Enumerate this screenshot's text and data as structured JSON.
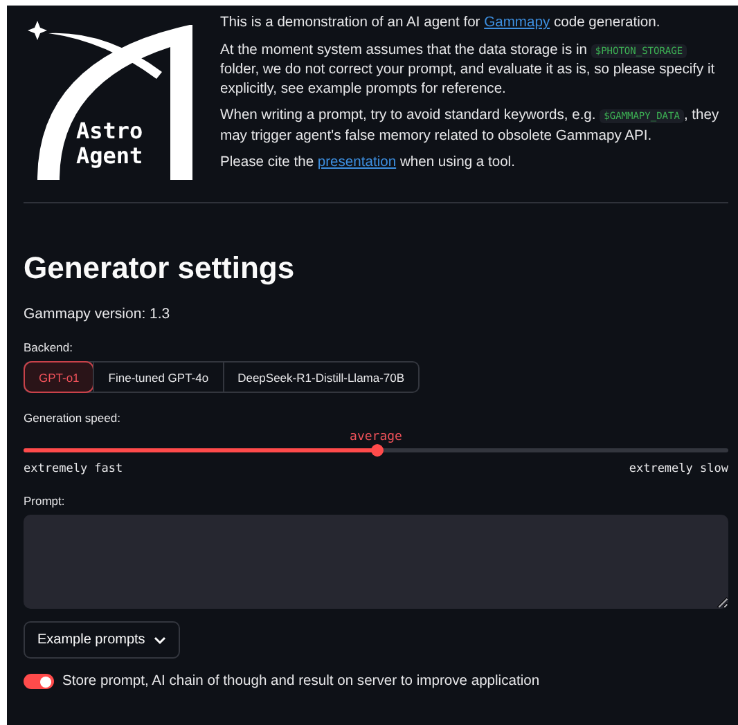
{
  "logo": {
    "lines": [
      "Astro",
      "Agent"
    ]
  },
  "intro": [
    [
      {
        "kind": "text",
        "text": "This is a demonstration of an AI agent for "
      },
      {
        "kind": "link",
        "text": "Gammapy"
      },
      {
        "kind": "text",
        "text": " code generation."
      }
    ],
    [
      {
        "kind": "text",
        "text": "At the moment system assumes that the data storage is in "
      },
      {
        "kind": "code",
        "text": "$PHOTON_STORAGE"
      },
      {
        "kind": "text",
        "text": " folder, we do not correct your prompt, and evaluate it as is, so please specify it explicitly, see example prompts for reference."
      }
    ],
    [
      {
        "kind": "text",
        "text": "When writing a prompt, try to avoid standard keywords, e.g. "
      },
      {
        "kind": "code",
        "text": "$GAMMAPY_DATA"
      },
      {
        "kind": "text",
        "text": ", they may trigger agent's false memory related to obsolete Gammapy API."
      }
    ],
    [
      {
        "kind": "text",
        "text": "Please cite the "
      },
      {
        "kind": "link",
        "text": "presentation"
      },
      {
        "kind": "text",
        "text": " when using a tool."
      }
    ]
  ],
  "heading": "Generator settings",
  "version": "Gammapy version: 1.3",
  "backend": {
    "label": "Backend:",
    "options": [
      {
        "label": "GPT-o1",
        "selected": true
      },
      {
        "label": "Fine-tuned GPT-4o",
        "selected": false
      },
      {
        "label": "DeepSeek-R1-Distill-Llama-70B",
        "selected": false
      }
    ]
  },
  "speed": {
    "label": "Generation speed:",
    "value": "average",
    "level": 0.5,
    "min_label": "extremely fast",
    "max_label": "extremely slow"
  },
  "prompt": {
    "label": "Prompt:"
  },
  "example_button": "Example prompts",
  "store_toggle": {
    "label": "Store prompt, AI chain of though and result on server to improve application",
    "on": true
  }
}
